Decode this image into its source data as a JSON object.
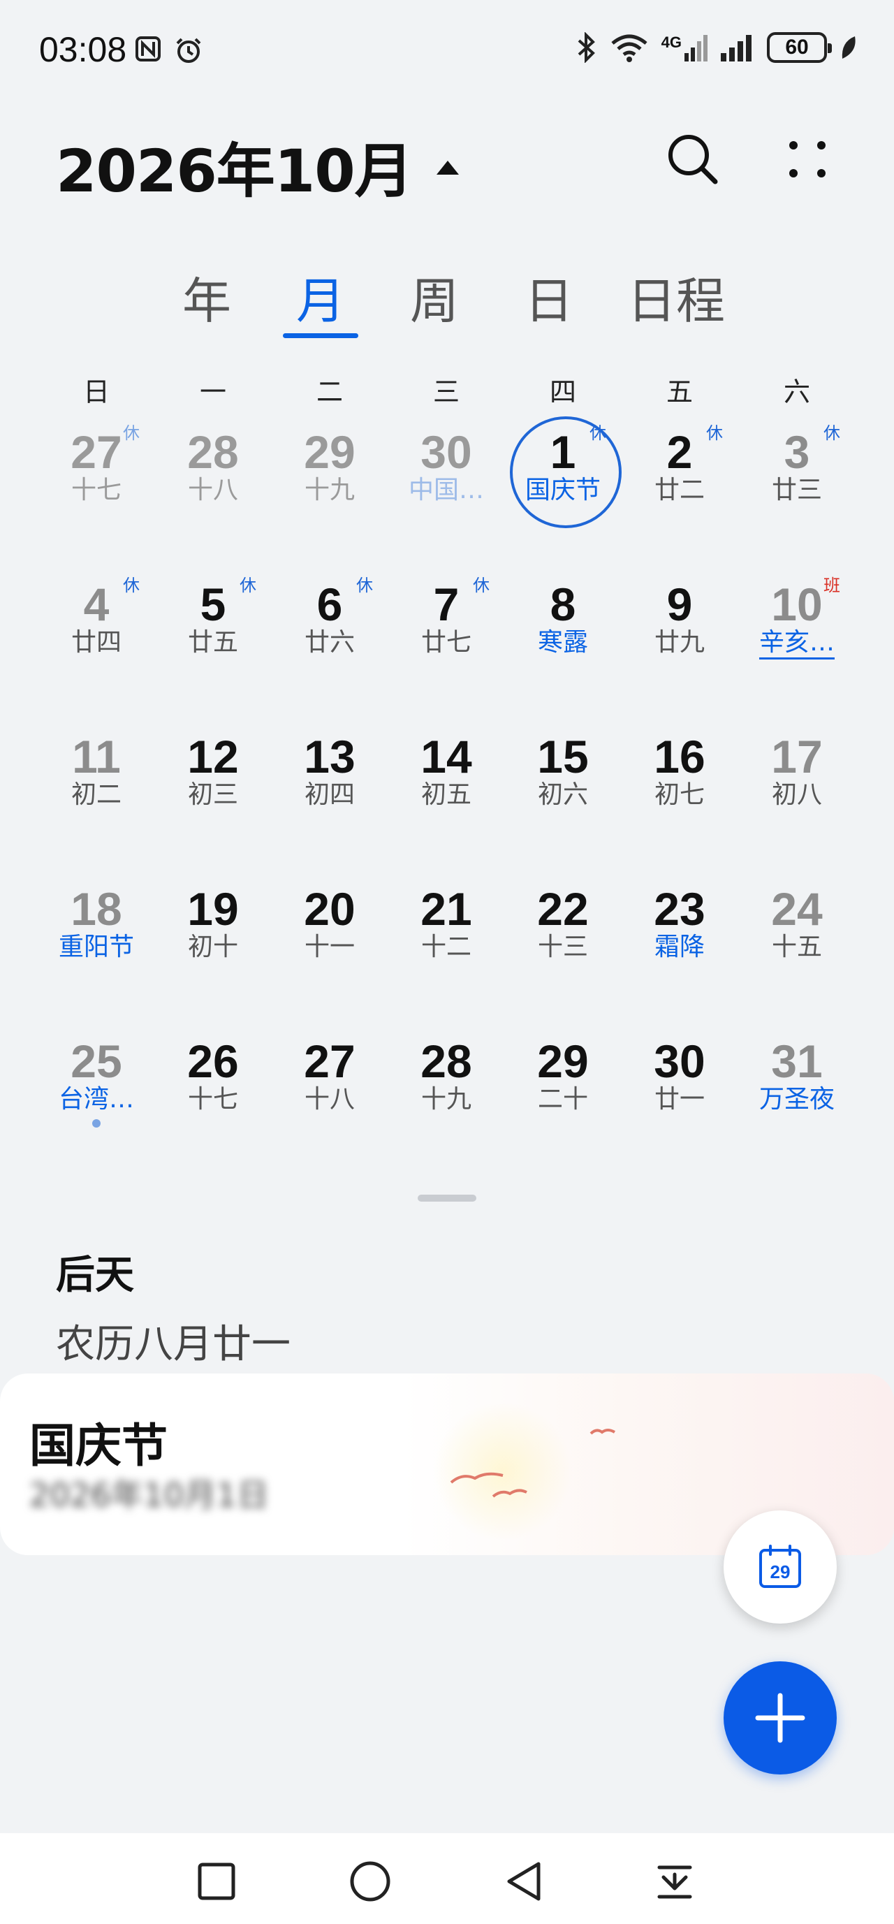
{
  "status_bar": {
    "time": "03:08",
    "battery": "60",
    "network_label": "4G"
  },
  "header": {
    "month_title": "2026年10月"
  },
  "tabs": [
    {
      "label": "年",
      "active": false
    },
    {
      "label": "月",
      "active": true
    },
    {
      "label": "周",
      "active": false
    },
    {
      "label": "日",
      "active": false
    },
    {
      "label": "日程",
      "active": false
    }
  ],
  "weekdays": [
    "日",
    "一",
    "二",
    "三",
    "四",
    "五",
    "六"
  ],
  "calendar": {
    "weeks": [
      [
        {
          "day": "27",
          "sub": "十七",
          "badge": "休",
          "muted": true
        },
        {
          "day": "28",
          "sub": "十八",
          "muted": true
        },
        {
          "day": "29",
          "sub": "十九",
          "muted": true
        },
        {
          "day": "30",
          "sub": "中国…",
          "muted": true,
          "sub_blue": true
        },
        {
          "day": "1",
          "sub": "国庆节",
          "badge": "休",
          "sub_blue": true,
          "ring": true
        },
        {
          "day": "2",
          "sub": "廿二",
          "badge": "休"
        },
        {
          "day": "3",
          "sub": "廿三",
          "badge": "休",
          "weekend": true
        }
      ],
      [
        {
          "day": "4",
          "sub": "廿四",
          "badge": "休",
          "weekend": true
        },
        {
          "day": "5",
          "sub": "廿五",
          "badge": "休"
        },
        {
          "day": "6",
          "sub": "廿六",
          "badge": "休"
        },
        {
          "day": "7",
          "sub": "廿七",
          "badge": "休"
        },
        {
          "day": "8",
          "sub": "寒露",
          "sub_blue": true
        },
        {
          "day": "9",
          "sub": "廿九"
        },
        {
          "day": "10",
          "sub": "辛亥…",
          "badge": "班",
          "badge_red": true,
          "sub_blue": true,
          "underline": true,
          "weekend": true
        }
      ],
      [
        {
          "day": "11",
          "sub": "初二",
          "weekend": true
        },
        {
          "day": "12",
          "sub": "初三"
        },
        {
          "day": "13",
          "sub": "初四"
        },
        {
          "day": "14",
          "sub": "初五"
        },
        {
          "day": "15",
          "sub": "初六"
        },
        {
          "day": "16",
          "sub": "初七"
        },
        {
          "day": "17",
          "sub": "初八",
          "weekend": true
        }
      ],
      [
        {
          "day": "18",
          "sub": "重阳节",
          "sub_blue": true,
          "weekend": true
        },
        {
          "day": "19",
          "sub": "初十"
        },
        {
          "day": "20",
          "sub": "十一"
        },
        {
          "day": "21",
          "sub": "十二"
        },
        {
          "day": "22",
          "sub": "十三"
        },
        {
          "day": "23",
          "sub": "霜降",
          "sub_blue": true
        },
        {
          "day": "24",
          "sub": "十五",
          "weekend": true
        }
      ],
      [
        {
          "day": "25",
          "sub": "台湾…",
          "sub_blue": true,
          "weekend": true,
          "dot": true
        },
        {
          "day": "26",
          "sub": "十七"
        },
        {
          "day": "27",
          "sub": "十八"
        },
        {
          "day": "28",
          "sub": "十九"
        },
        {
          "day": "29",
          "sub": "二十"
        },
        {
          "day": "30",
          "sub": "廿一"
        },
        {
          "day": "31",
          "sub": "万圣夜",
          "sub_blue": true,
          "weekend": true
        }
      ]
    ]
  },
  "day_info": {
    "relative": "后天",
    "lunar": "农历八月廿一"
  },
  "event": {
    "title": "国庆节",
    "date": "2026年10月1日"
  },
  "today_button": {
    "day": "29"
  },
  "colors": {
    "accent": "#0b63e4",
    "holiday_badge": "#1f66d6",
    "work_badge": "#d93025",
    "muted": "#9a9a9a"
  },
  "icons": {
    "nfc": "nfc-icon",
    "alarm": "alarm-icon",
    "bluetooth": "bluetooth-icon",
    "wifi": "wifi-icon",
    "signal": "signal-icon",
    "search": "search-icon",
    "more": "more-icon",
    "add": "plus-icon",
    "today": "calendar-today-icon"
  }
}
